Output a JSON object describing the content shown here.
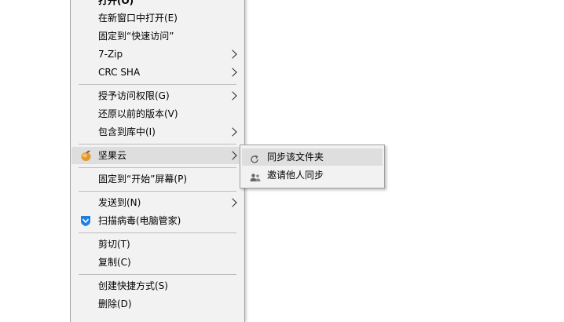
{
  "context_menu": {
    "items": [
      {
        "label": "打开(O)"
      },
      {
        "label": "在新窗口中打开(E)"
      },
      {
        "label": "固定到“快速访问”"
      },
      {
        "label": "7-Zip"
      },
      {
        "label": "CRC SHA"
      },
      {
        "label": "授予访问权限(G)"
      },
      {
        "label": "还原以前的版本(V)"
      },
      {
        "label": "包含到库中(I)"
      },
      {
        "label": "坚果云",
        "icon": "jianguoyun-nut-icon"
      },
      {
        "label": "固定到“开始”屏幕(P)"
      },
      {
        "label": "发送到(N)"
      },
      {
        "label": "扫描病毒(电脑管家)",
        "icon": "pc-manager-shield-icon"
      },
      {
        "label": "剪切(T)"
      },
      {
        "label": "复制(C)"
      },
      {
        "label": "创建快捷方式(S)"
      },
      {
        "label": "删除(D)"
      }
    ]
  },
  "submenu": {
    "items": [
      {
        "label": "同步该文件夹",
        "icon": "sync-icon"
      },
      {
        "label": "邀请他人同步",
        "icon": "people-icon"
      }
    ]
  },
  "colors": {
    "menu_bg": "#f2f2f2",
    "hover_bg": "#dedede",
    "separator": "#bdbdbd",
    "border": "#a0a0a0",
    "shield_blue": "#1e7fe0",
    "nut_orange": "#e3982e"
  }
}
